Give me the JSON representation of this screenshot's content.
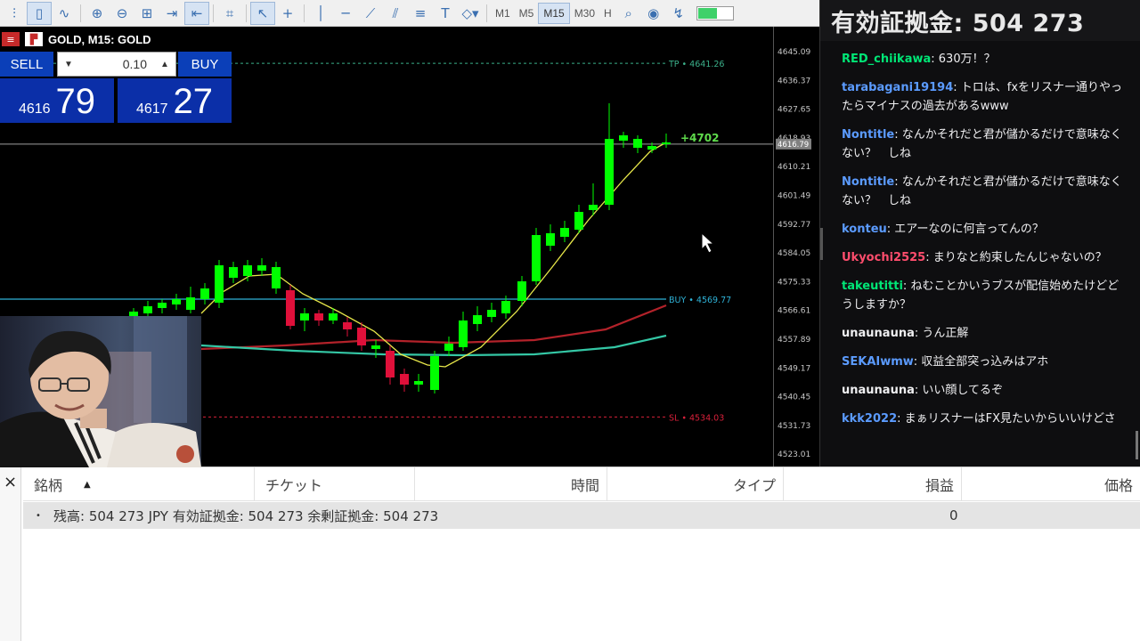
{
  "toolbar": {
    "icons": [
      "bar-chart-icon",
      "candle-icon",
      "line-chart-icon",
      "zoom-in-icon",
      "zoom-out-icon",
      "grid-icon",
      "autoscroll-icon",
      "chart-shift-icon",
      "screenshot-icon",
      "cursor-icon",
      "crosshair-icon",
      "vertical-line-icon",
      "horizontal-line-icon",
      "trend-line-icon",
      "channel-icon",
      "fibonacci-icon",
      "text-icon",
      "shapes-icon"
    ],
    "timeframes": [
      "M1",
      "M5",
      "M15",
      "M30",
      "H"
    ],
    "active_timeframe": "M15",
    "battery_level": 0.55
  },
  "chart": {
    "title": "GOLD, M15:  GOLD",
    "price_labels": [
      "4645.09",
      "4636.37",
      "4627.65",
      "4618.93",
      "4610.21",
      "4601.49",
      "4592.77",
      "4584.05",
      "4575.33",
      "4566.61",
      "4557.89",
      "4549.17",
      "4540.45",
      "4531.73",
      "4523.01"
    ],
    "current_price_tag": "4616.79",
    "tp_label": "TP • 4641.26",
    "buy_label": "BUY • 4569.77",
    "sl_label": "SL • 4534.03",
    "profit_label": "+4702",
    "colors": {
      "bull": "#00ff00",
      "bear": "#e0103a",
      "ma_fast": "#e8e84a",
      "ma_mid": "#b3222a",
      "ma_slow": "#34c7a5",
      "buy_line": "#2fb3d8",
      "tp": "#3bb08a",
      "sl": "#d8203a"
    }
  },
  "one_click": {
    "sell_label": "SELL",
    "buy_label": "BUY",
    "volume": "0.10",
    "sell_price_small": "4616",
    "sell_price_big": "79",
    "buy_price_small": "4617",
    "buy_price_big": "27"
  },
  "chat": {
    "margin_title": "有効証拠金: 504 273",
    "messages": [
      {
        "user": "RED_chiikawa",
        "color": "#00e676",
        "text": "630万！？"
      },
      {
        "user": "tarabagani19194",
        "color": "#5b9bff",
        "text": "トロは、fxをリスナー通りやったらマイナスの過去があるwww"
      },
      {
        "user": "Nontitle",
        "color": "#5b9bff",
        "text": "なんかそれだと君が儲かるだけで意味なくない？　しね"
      },
      {
        "user": "Nontitle",
        "color": "#5b9bff",
        "text": "なんかそれだと君が儲かるだけで意味なくない？　しね"
      },
      {
        "user": "konteu",
        "color": "#5b9bff",
        "text": "エアーなのに何言ってんの？"
      },
      {
        "user": "Ukyochi2525",
        "color": "#ff4d6d",
        "text": "まりなと約束したんじゃないの？"
      },
      {
        "user": "takeutitti",
        "color": "#00e676",
        "text": "ねむことかいうブスが配信始めたけどどうしますか？"
      },
      {
        "user": "unaunauna",
        "color": "#efeff1",
        "text": "うん正解"
      },
      {
        "user": "SEKAIwmw",
        "color": "#5b9bff",
        "text": "収益全部突っ込みはアホ"
      },
      {
        "user": "unaunauna",
        "color": "#efeff1",
        "text": "いい顔してるぞ"
      },
      {
        "user": "kkk2022",
        "color": "#5b9bff",
        "text": "まぁリスナーはFX見たいからいいけどさ"
      }
    ]
  },
  "terminal": {
    "close_label": "×",
    "columns": [
      "銘柄",
      "チケット",
      "時間",
      "タイプ",
      "損益",
      "価格"
    ],
    "balance_text": "残高: 504 273 JPY  有効証拠金: 504 273  余剰証拠金: 504 273",
    "profit_value": "0"
  }
}
